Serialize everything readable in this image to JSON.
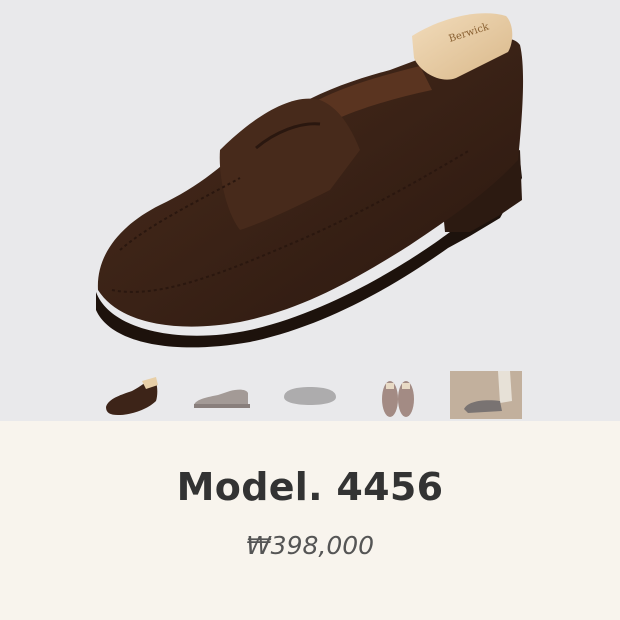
{
  "product": {
    "title": "Model. 4456",
    "price": "₩398,000"
  },
  "gallery": {
    "selected_index": 0,
    "thumbnails": [
      {
        "icon": "loafer-side-icon"
      },
      {
        "icon": "shoe-side-icon"
      },
      {
        "icon": "shoe-sole-icon"
      },
      {
        "icon": "loafer-pair-icon"
      },
      {
        "icon": "worn-shoe-photo-icon"
      }
    ]
  },
  "colors": {
    "gallery_bg": "#e9e9eb",
    "info_bg": "#f8f4ed",
    "title": "#333333",
    "price": "#555555",
    "suede": "#3d2418"
  }
}
